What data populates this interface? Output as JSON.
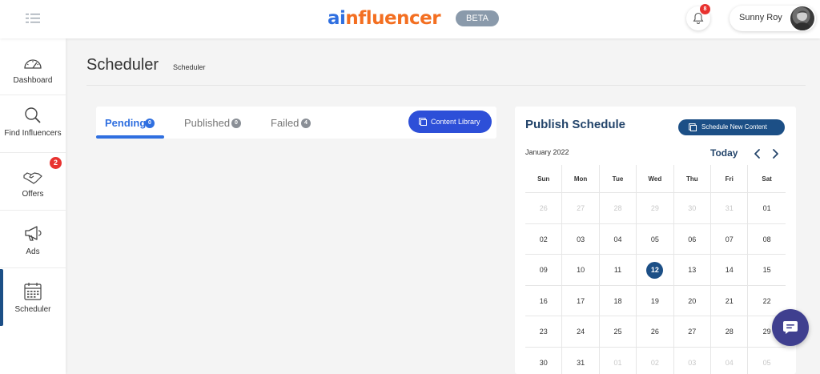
{
  "header": {
    "logo_a": "ai",
    "logo_rest": "nfluencer",
    "beta": "BETA",
    "notifications_count": "8",
    "user_name": "Sunny Roy"
  },
  "sidebar": {
    "items": [
      {
        "label": "Dashboard",
        "icon": "gauge-icon"
      },
      {
        "label": "Find Influencers",
        "icon": "search-icon"
      },
      {
        "label": "Offers",
        "icon": "handshake-icon",
        "badge": "2"
      },
      {
        "label": "Ads",
        "icon": "megaphone-icon"
      },
      {
        "label": "Scheduler",
        "icon": "calendar-icon",
        "active": true
      }
    ]
  },
  "page": {
    "title": "Scheduler",
    "breadcrumb": "Scheduler"
  },
  "tabs": [
    {
      "label": "Pending",
      "count": "0",
      "active": true
    },
    {
      "label": "Published",
      "count": "0"
    },
    {
      "label": "Failed",
      "count": "4"
    }
  ],
  "content_library_label": "Content Library",
  "publish": {
    "title": "Publish Schedule",
    "schedule_button": "Schedule New Content",
    "month": "January 2022",
    "today": "Today",
    "weekdays": [
      "Sun",
      "Mon",
      "Tue",
      "Wed",
      "Thu",
      "Fri",
      "Sat"
    ],
    "weeks": [
      [
        "26",
        "27",
        "28",
        "29",
        "30",
        "31",
        "01"
      ],
      [
        "02",
        "03",
        "04",
        "05",
        "06",
        "07",
        "08"
      ],
      [
        "09",
        "10",
        "11",
        "12",
        "13",
        "14",
        "15"
      ],
      [
        "16",
        "17",
        "18",
        "19",
        "20",
        "21",
        "22"
      ],
      [
        "23",
        "24",
        "25",
        "26",
        "27",
        "28",
        "29"
      ],
      [
        "30",
        "31",
        "01",
        "02",
        "03",
        "04",
        "05"
      ]
    ],
    "selected_day": "12"
  },
  "colors": {
    "accent_blue": "#2f6fe0",
    "brand_orange": "#f36f21",
    "navy": "#1c4f86",
    "badge_red": "#e8322f",
    "chat_purple": "#3f3f8f"
  }
}
